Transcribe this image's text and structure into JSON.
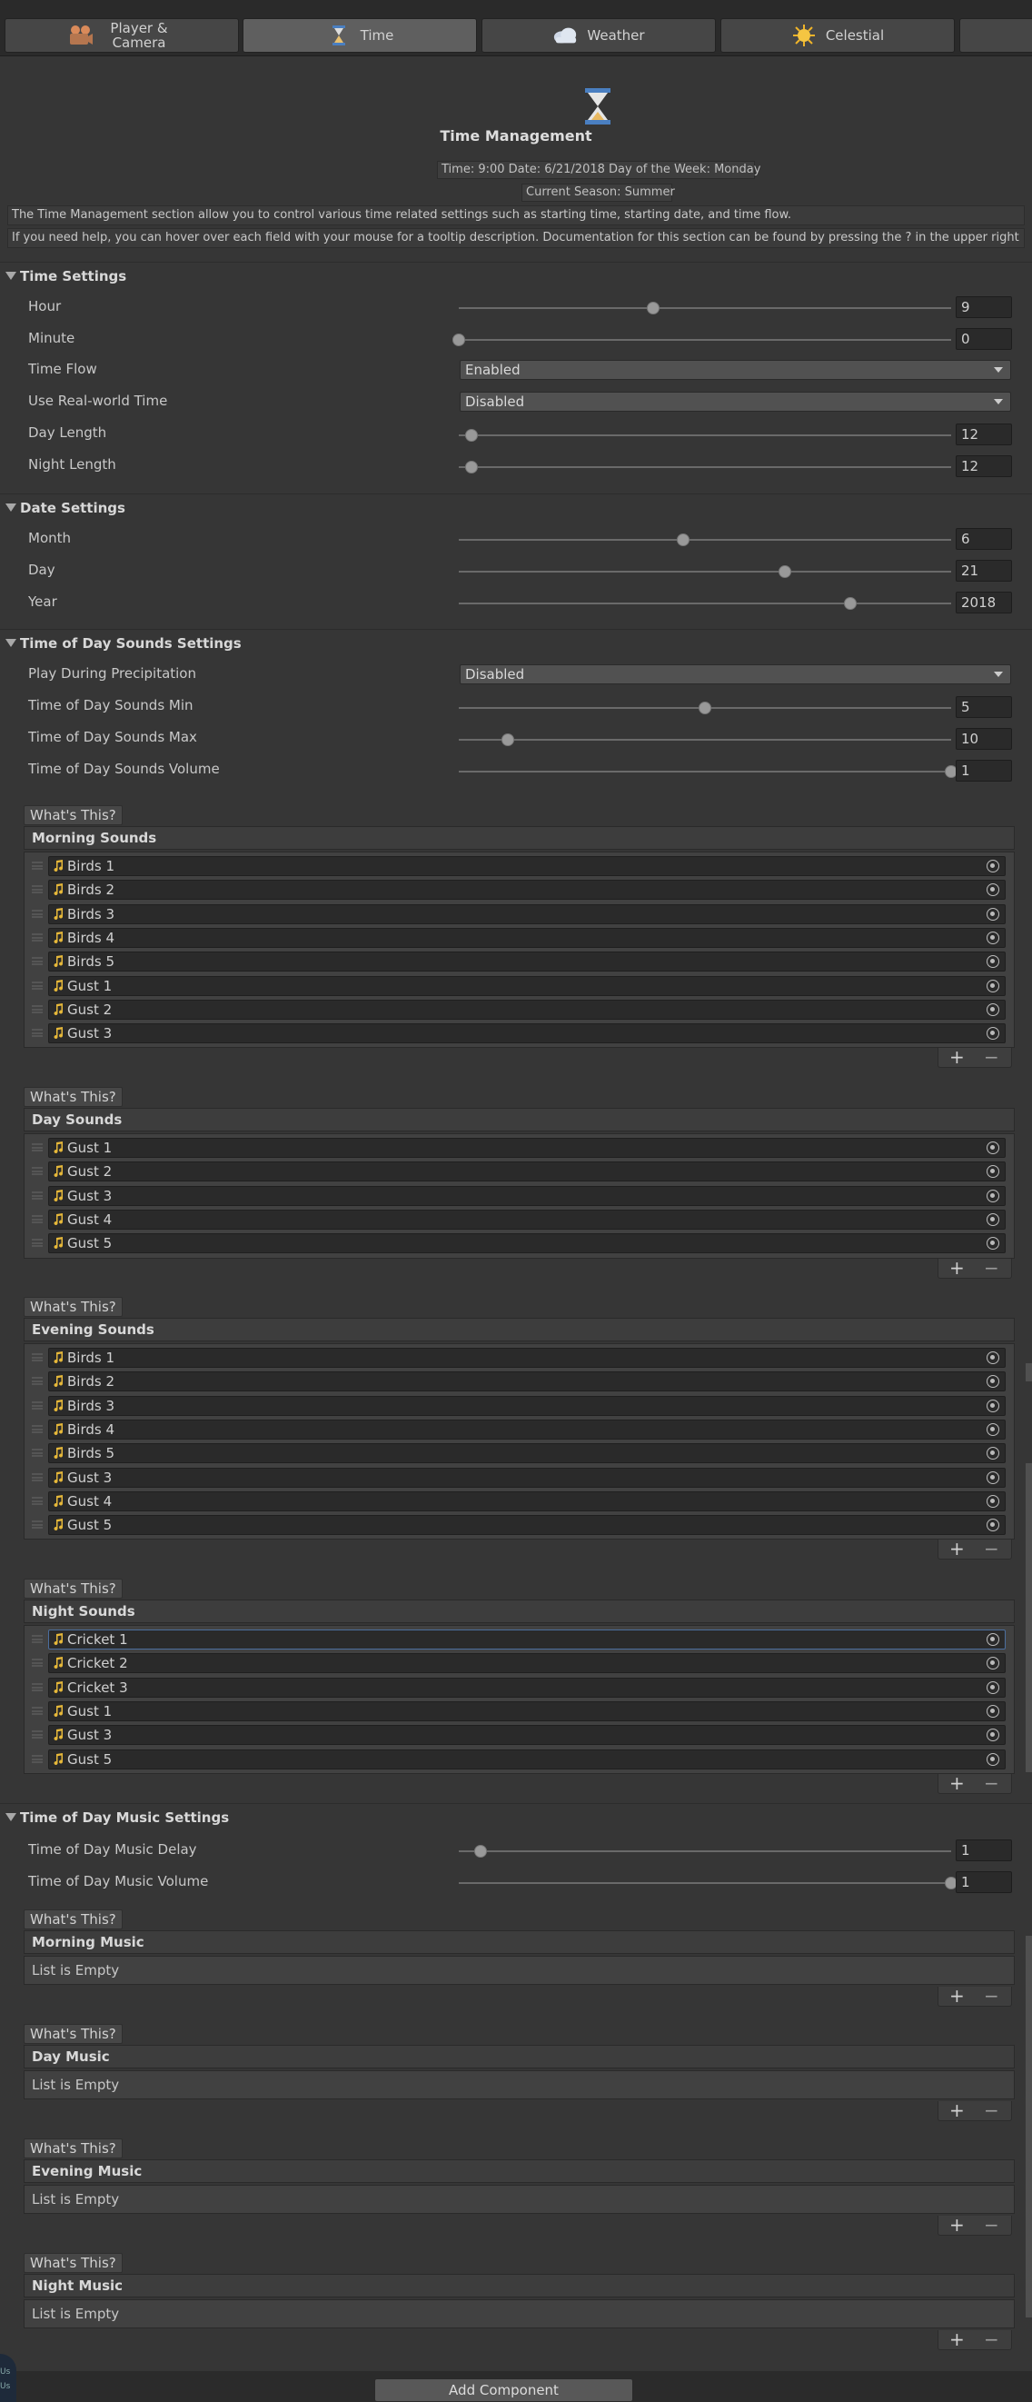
{
  "tabs": [
    {
      "label": "Player &\nCamera",
      "icon": "camera-icon"
    },
    {
      "label": "Time",
      "icon": "hourglass-icon"
    },
    {
      "label": "Weather",
      "icon": "cloud-icon"
    },
    {
      "label": "Celestial",
      "icon": "sun-icon"
    }
  ],
  "header": {
    "title": "Time Management",
    "time_info": "Time: 9:00  Date: 6/21/2018  Day of the Week: Monday",
    "season_info": "Current Season: Summer",
    "desc1": "The Time Management section allow you to control various time related settings such as starting time, starting date, and time flow.",
    "desc2": "If you need help, you can hover over each field with your mouse for a tooltip description. Documentation for this section can be found by pressing the ? in the upper right hand"
  },
  "time_settings": {
    "title": "Time Settings",
    "hour": {
      "label": "Hour",
      "value": "9",
      "fraction": 0.395
    },
    "minute": {
      "label": "Minute",
      "value": "0",
      "fraction": 0.0
    },
    "time_flow": {
      "label": "Time Flow",
      "value": "Enabled"
    },
    "real_world": {
      "label": "Use Real-world Time",
      "value": "Disabled"
    },
    "day_length": {
      "label": "Day Length",
      "value": "12",
      "fraction": 0.025
    },
    "night_length": {
      "label": "Night Length",
      "value": "12",
      "fraction": 0.025
    }
  },
  "date_settings": {
    "title": "Date Settings",
    "month": {
      "label": "Month",
      "value": "6",
      "fraction": 0.455
    },
    "day": {
      "label": "Day",
      "value": "21",
      "fraction": 0.663
    },
    "year": {
      "label": "Year",
      "value": "2018",
      "fraction": 0.795
    }
  },
  "tod_sounds": {
    "title": "Time of Day Sounds Settings",
    "play_precip": {
      "label": "Play During Precipitation",
      "value": "Disabled"
    },
    "min": {
      "label": "Time of Day Sounds Min",
      "value": "5",
      "fraction": 0.5
    },
    "max": {
      "label": "Time of Day Sounds Max",
      "value": "10",
      "fraction": 0.1
    },
    "volume": {
      "label": "Time of Day Sounds Volume",
      "value": "1",
      "fraction": 1.0
    }
  },
  "whats_this": "What's This?",
  "sound_lists": [
    {
      "title": "Morning Sounds",
      "items": [
        "Birds 1",
        "Birds 2",
        "Birds 3",
        "Birds 4",
        "Birds 5",
        "Gust 1",
        "Gust 2",
        "Gust 3"
      ]
    },
    {
      "title": "Day Sounds",
      "items": [
        "Gust 1",
        "Gust 2",
        "Gust 3",
        "Gust 4",
        "Gust 5"
      ]
    },
    {
      "title": "Evening Sounds",
      "items": [
        "Birds 1",
        "Birds 2",
        "Birds 3",
        "Birds 4",
        "Birds 5",
        "Gust 3",
        "Gust 4",
        "Gust 5"
      ]
    },
    {
      "title": "Night Sounds",
      "items": [
        "Cricket 1",
        "Cricket 2",
        "Cricket 3",
        "Gust 1",
        "Gust 3",
        "Gust 5"
      ]
    }
  ],
  "tod_music": {
    "title": "Time of Day Music Settings",
    "delay": {
      "label": "Time of Day Music Delay",
      "value": "1",
      "fraction": 0.045
    },
    "volume": {
      "label": "Time of Day Music Volume",
      "value": "1",
      "fraction": 1.0
    }
  },
  "music_lists": [
    {
      "title": "Morning Music",
      "empty": "List is Empty"
    },
    {
      "title": "Day Music",
      "empty": "List is Empty"
    },
    {
      "title": "Evening Music",
      "empty": "List is Empty"
    },
    {
      "title": "Night Music",
      "empty": "List is Empty"
    }
  ],
  "add_component": "Add Component",
  "plus": "+",
  "minus": "−",
  "corner_text": "Us\nUs"
}
